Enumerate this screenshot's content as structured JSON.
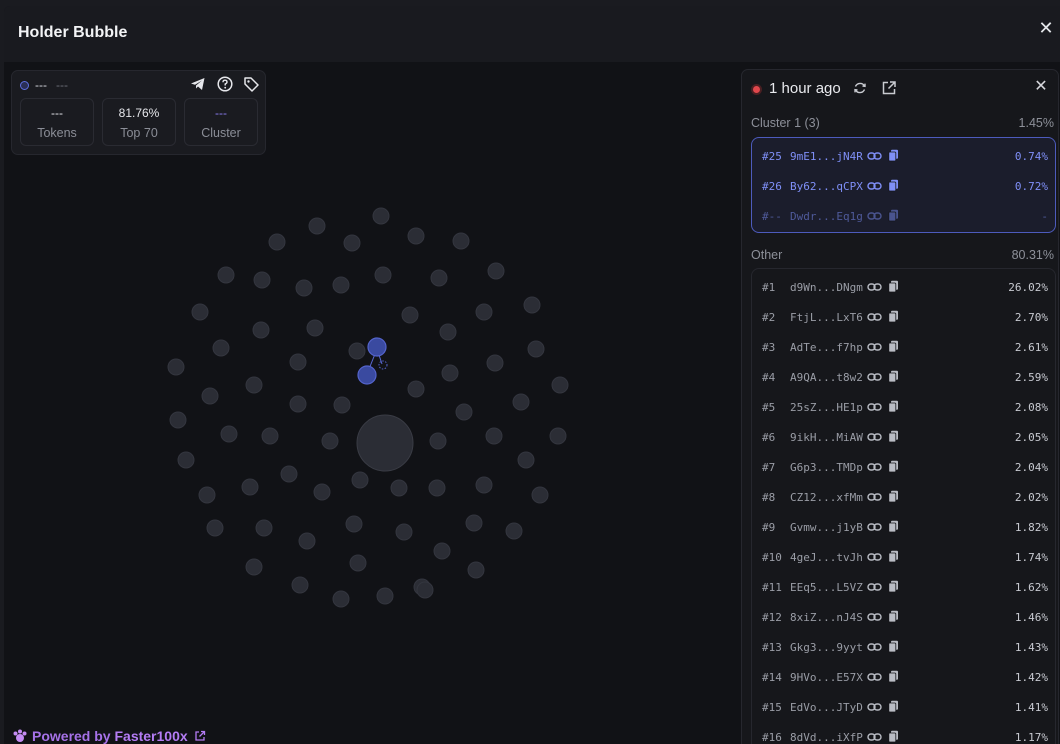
{
  "modal": {
    "title": "Holder Bubble",
    "close_glyph": "✕"
  },
  "info_card": {
    "token_name": "---",
    "token_symbol": "---",
    "icons": [
      "telegram-icon",
      "help-icon",
      "tag-icon"
    ],
    "stats": [
      {
        "value": "---",
        "label": "Tokens"
      },
      {
        "value": "81.76%",
        "label": "Top 70"
      },
      {
        "value": "---",
        "label": "Cluster"
      }
    ]
  },
  "panel": {
    "time_ago": "1 hour ago",
    "close_glyph": "✕",
    "cluster": {
      "label": "Cluster 1 (3)",
      "percent": "1.45%",
      "rows": [
        {
          "rank": "#25",
          "address": "9mE1...jN4R",
          "percent": "0.74%"
        },
        {
          "rank": "#26",
          "address": "By62...qCPX",
          "percent": "0.72%"
        },
        {
          "rank": "#--",
          "address": "Dwdr...Eq1g",
          "percent": "-"
        }
      ]
    },
    "other": {
      "label": "Other",
      "percent": "80.31%",
      "rows": [
        {
          "rank": "#1",
          "address": "d9Wn...DNgm",
          "percent": "26.02%"
        },
        {
          "rank": "#2",
          "address": "FtjL...LxT6",
          "percent": "2.70%"
        },
        {
          "rank": "#3",
          "address": "AdTe...f7hp",
          "percent": "2.61%"
        },
        {
          "rank": "#4",
          "address": "A9QA...t8w2",
          "percent": "2.59%"
        },
        {
          "rank": "#5",
          "address": "25sZ...HE1p",
          "percent": "2.08%"
        },
        {
          "rank": "#6",
          "address": "9ikH...MiAW",
          "percent": "2.05%"
        },
        {
          "rank": "#7",
          "address": "G6p3...TMDp",
          "percent": "2.04%"
        },
        {
          "rank": "#8",
          "address": "CZ12...xfMm",
          "percent": "2.02%"
        },
        {
          "rank": "#9",
          "address": "Gvmw...j1yB",
          "percent": "1.82%"
        },
        {
          "rank": "#10",
          "address": "4geJ...tvJh",
          "percent": "1.74%"
        },
        {
          "rank": "#11",
          "address": "EEq5...L5VZ",
          "percent": "1.62%"
        },
        {
          "rank": "#12",
          "address": "8xiZ...nJ4S",
          "percent": "1.46%"
        },
        {
          "rank": "#13",
          "address": "Gkg3...9yyt",
          "percent": "1.43%"
        },
        {
          "rank": "#14",
          "address": "9HVo...E57X",
          "percent": "1.42%"
        },
        {
          "rank": "#15",
          "address": "EdVo...JTyD",
          "percent": "1.41%"
        },
        {
          "rank": "#16",
          "address": "8dVd...iXfP",
          "percent": "1.17%"
        }
      ]
    }
  },
  "footer": {
    "powered_prefix": "Powered by",
    "brand": "Faster100x"
  },
  "colors": {
    "accent": "#7f8ff7",
    "brand": "#b47cf4",
    "bubble": "#2d2f37",
    "cluster_bubble": "#3d4ea6",
    "live_dot": "#e0474c"
  }
}
